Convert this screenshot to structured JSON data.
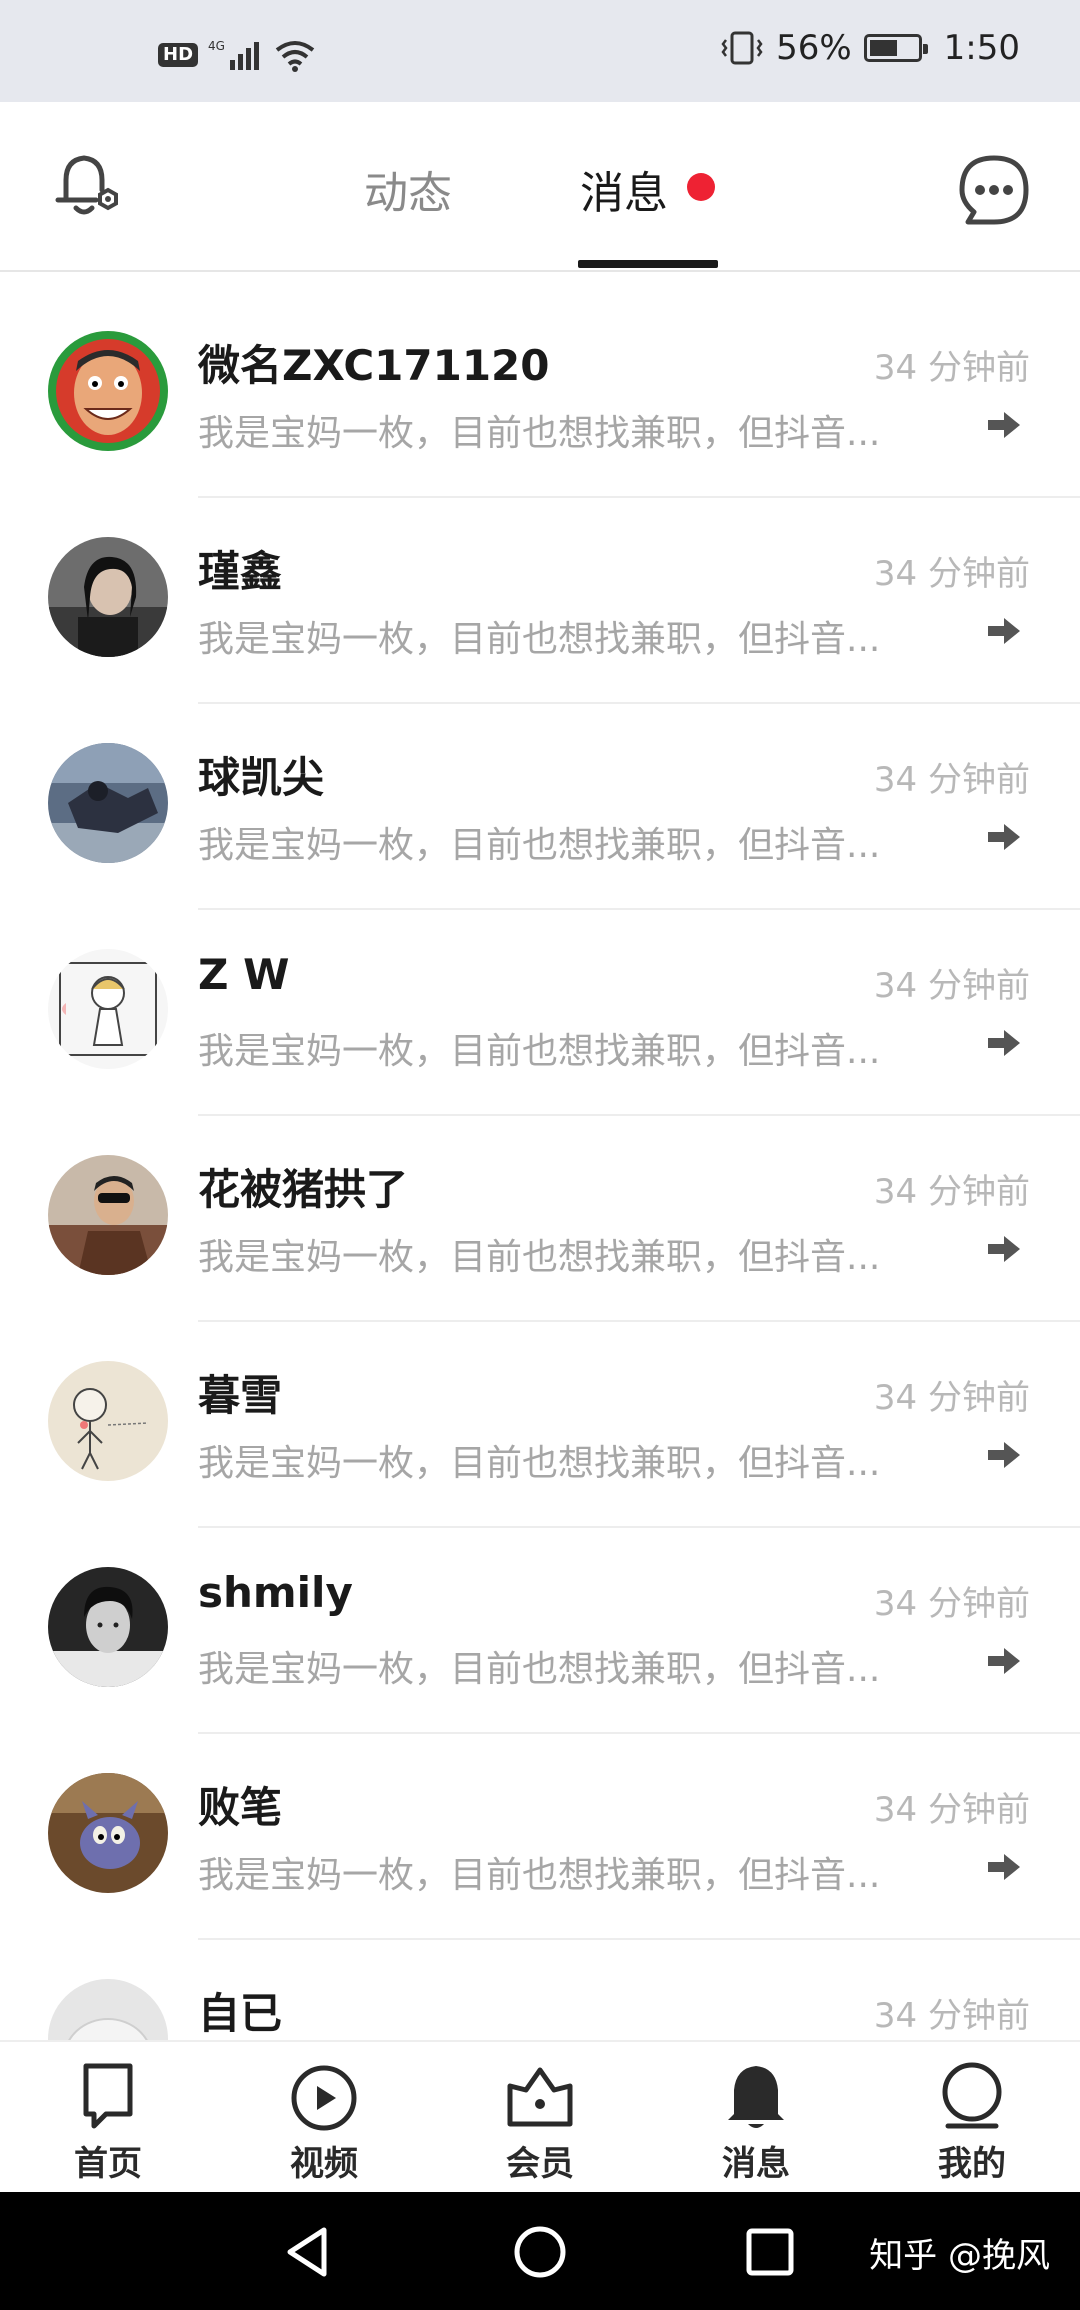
{
  "status_bar": {
    "hd": "HD",
    "network": "4G",
    "battery_percent": "56%",
    "time": "1:50",
    "battery_level": 0.56
  },
  "top_nav": {
    "tabs": [
      {
        "label": "动态",
        "active": false
      },
      {
        "label": "消息",
        "active": true,
        "has_dot": true
      }
    ],
    "left_icon": "notification-settings-icon",
    "right_icon": "chat-bubble-icon",
    "dot_color": "#ee2233"
  },
  "messages": [
    {
      "name": "微名ZXC171120",
      "time": "34 分钟前",
      "preview": "我是宝妈一枚，目前也想找兼职，但抖音..."
    },
    {
      "name": "瑾鑫",
      "time": "34 分钟前",
      "preview": "我是宝妈一枚，目前也想找兼职，但抖音..."
    },
    {
      "name": "球凯尖",
      "time": "34 分钟前",
      "preview": "我是宝妈一枚，目前也想找兼职，但抖音..."
    },
    {
      "name": "Z W",
      "time": "34 分钟前",
      "preview": "我是宝妈一枚，目前也想找兼职，但抖音..."
    },
    {
      "name": "花被猪拱了",
      "time": "34 分钟前",
      "preview": "我是宝妈一枚，目前也想找兼职，但抖音..."
    },
    {
      "name": "暮雪",
      "time": "34 分钟前",
      "preview": "我是宝妈一枚，目前也想找兼职，但抖音..."
    },
    {
      "name": "shmily",
      "time": "34 分钟前",
      "preview": "我是宝妈一枚，目前也想找兼职，但抖音..."
    },
    {
      "name": "败笔",
      "time": "34 分钟前",
      "preview": "我是宝妈一枚，目前也想找兼职，但抖音..."
    },
    {
      "name": "自已",
      "time": "34 分钟前",
      "preview": ""
    }
  ],
  "bottom_tabs": [
    {
      "label": "首页",
      "icon": "home-card-icon"
    },
    {
      "label": "视频",
      "icon": "video-play-icon"
    },
    {
      "label": "会员",
      "icon": "crown-icon"
    },
    {
      "label": "消息",
      "icon": "bell-icon",
      "active": true
    },
    {
      "label": "我的",
      "icon": "profile-circle-icon"
    }
  ],
  "system_nav": {
    "watermark": "知乎 @挽风"
  }
}
